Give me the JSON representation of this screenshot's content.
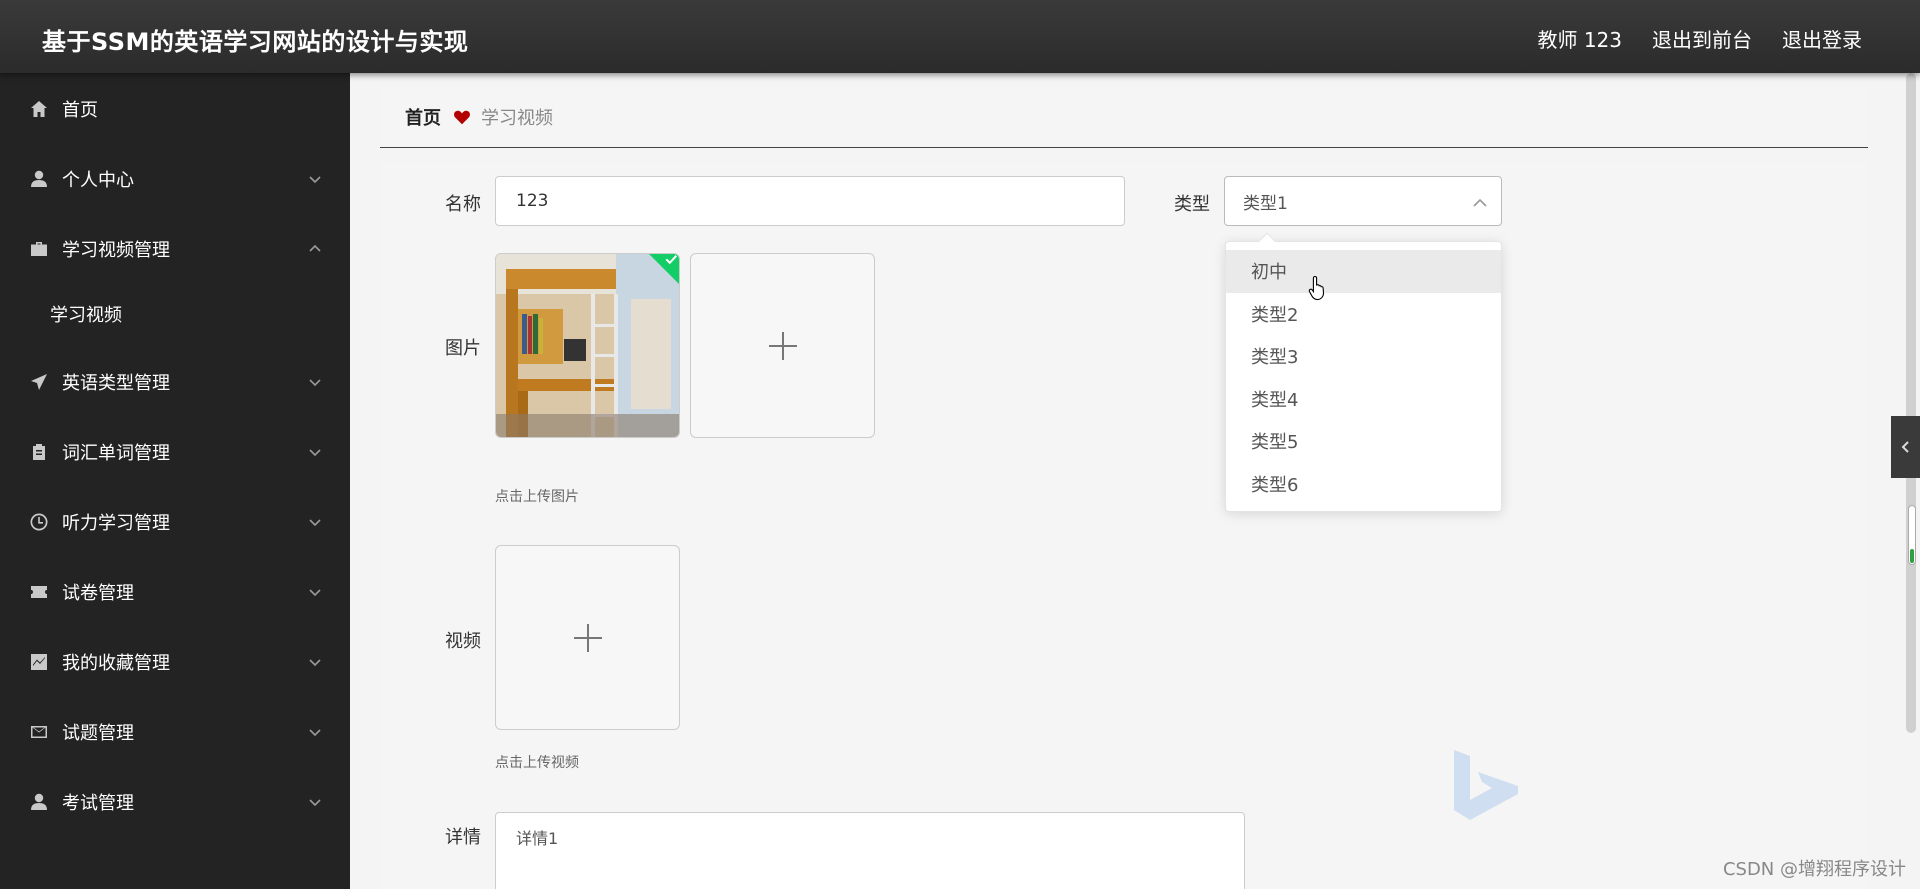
{
  "header": {
    "title": "基于SSM的英语学习网站的设计与实现",
    "user_label": "教师 123",
    "to_front_label": "退出到前台",
    "logout_label": "退出登录"
  },
  "sidebar": {
    "items": [
      {
        "label": "首页",
        "icon": "home-icon"
      },
      {
        "label": "个人中心",
        "icon": "user-icon"
      },
      {
        "label": "学习视频管理",
        "icon": "briefcase-icon",
        "expanded": true,
        "children": [
          "学习视频"
        ]
      },
      {
        "label": "英语类型管理",
        "icon": "send-icon"
      },
      {
        "label": "词汇单词管理",
        "icon": "clipboard-icon"
      },
      {
        "label": "听力学习管理",
        "icon": "clock-icon"
      },
      {
        "label": "试卷管理",
        "icon": "ticket-icon"
      },
      {
        "label": "我的收藏管理",
        "icon": "chart-icon"
      },
      {
        "label": "试题管理",
        "icon": "mail-icon"
      },
      {
        "label": "考试管理",
        "icon": "person-icon"
      }
    ]
  },
  "breadcrumb": {
    "home": "首页",
    "current": "学习视频",
    "separator_icon": "heart-icon",
    "separator_color": "#b30000"
  },
  "form": {
    "name_label": "名称",
    "name_value": "123",
    "type_label": "类型",
    "type_value": "类型1",
    "image_label": "图片",
    "image_hint": "点击上传图片",
    "video_label": "视频",
    "video_hint": "点击上传视频",
    "detail_label": "详情",
    "detail_value": "详情1"
  },
  "type_dropdown": {
    "options": [
      "初中",
      "类型2",
      "类型3",
      "类型4",
      "类型5",
      "类型6"
    ],
    "hovered_index": 0
  },
  "watermark": "CSDN @增翔程序设计",
  "colors": {
    "header_bg": "#2f2f2f",
    "sidebar_bg": "#232323",
    "success_badge": "#13ce66"
  }
}
